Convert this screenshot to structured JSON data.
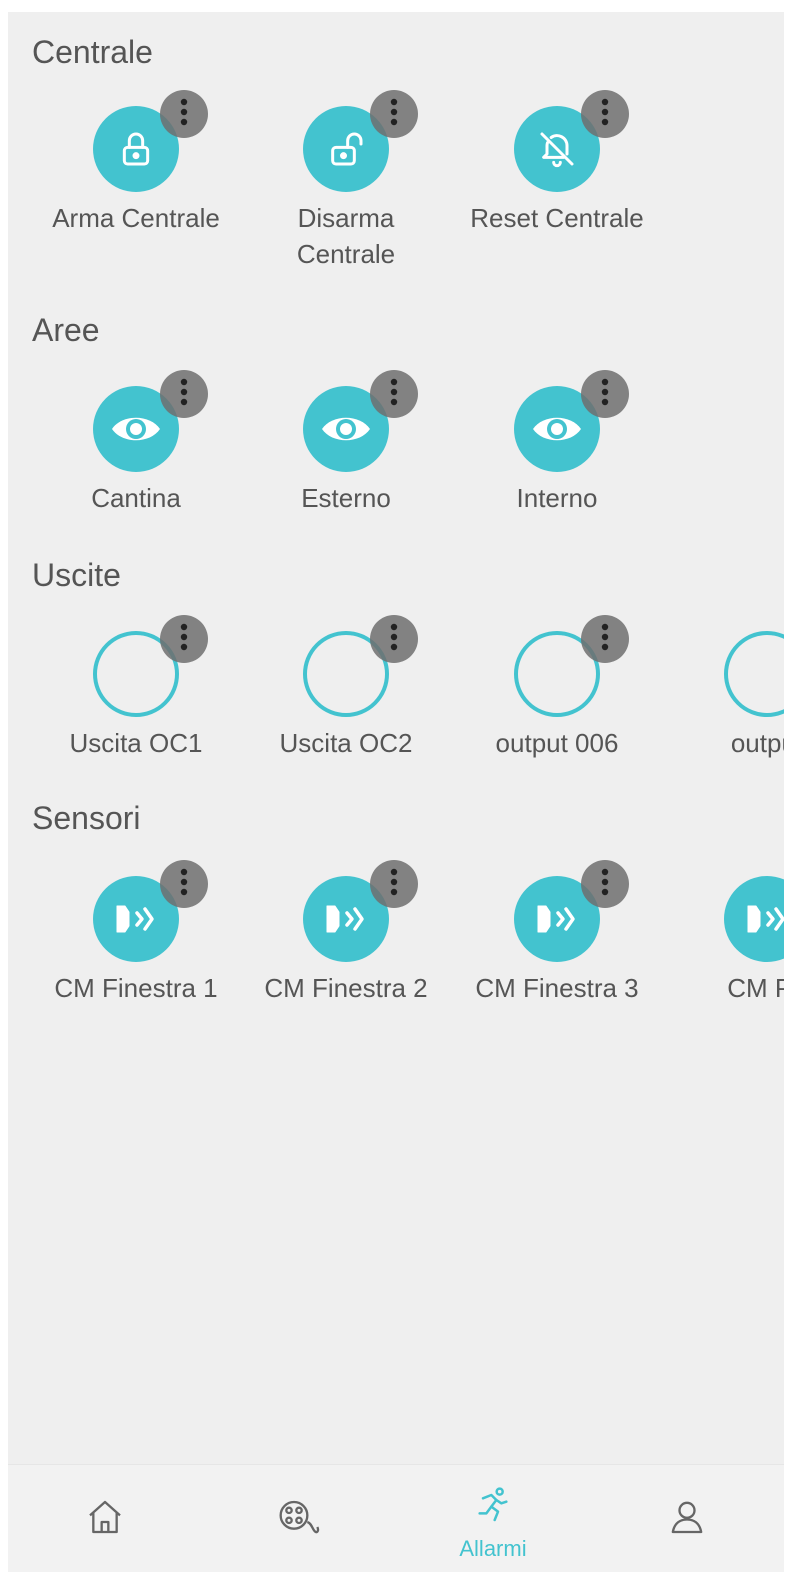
{
  "colors": {
    "accent": "#43c3cf",
    "menu_badge": "#6e6e6e",
    "text": "#555555",
    "background": "#efefef"
  },
  "sections": {
    "centrale": {
      "title": "Centrale",
      "items": [
        {
          "label": "Arma Centrale",
          "icon": "lock-icon"
        },
        {
          "label": "Disarma Centrale",
          "icon": "unlock-icon"
        },
        {
          "label": "Reset Centrale",
          "icon": "bell-off-icon"
        }
      ]
    },
    "aree": {
      "title": "Aree",
      "items": [
        {
          "label": "Cantina",
          "icon": "eye-icon"
        },
        {
          "label": "Esterno",
          "icon": "eye-icon"
        },
        {
          "label": "Interno",
          "icon": "eye-icon"
        }
      ]
    },
    "uscite": {
      "title": "Uscite",
      "items": [
        {
          "label": "Uscita OC1",
          "icon": "output-ring-icon"
        },
        {
          "label": "Uscita OC2",
          "icon": "output-ring-icon"
        },
        {
          "label": "output 006",
          "icon": "output-ring-icon"
        },
        {
          "label": "output",
          "icon": "output-ring-icon"
        }
      ]
    },
    "sensori": {
      "title": "Sensori",
      "items": [
        {
          "label": "CM Finestra 1",
          "icon": "door-sensor-icon"
        },
        {
          "label": "CM Finestra 2",
          "icon": "door-sensor-icon"
        },
        {
          "label": "CM Finestra 3",
          "icon": "door-sensor-icon"
        },
        {
          "label": "CM Po",
          "icon": "door-sensor-icon"
        }
      ]
    }
  },
  "bottom_nav": {
    "items": [
      {
        "icon": "home-icon"
      },
      {
        "icon": "media-icon"
      },
      {
        "icon": "running-person-icon",
        "label": "Allarmi",
        "active": true
      },
      {
        "icon": "user-icon"
      }
    ]
  }
}
